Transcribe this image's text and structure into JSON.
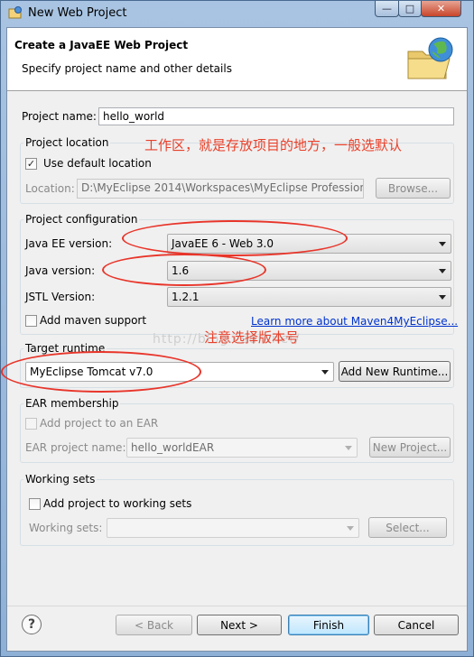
{
  "window": {
    "title": "New Web Project"
  },
  "header": {
    "title": "Create a JavaEE Web Project",
    "subtitle": "Specify project name and other details"
  },
  "project_name": {
    "label": "Project name:",
    "value": "hello_world"
  },
  "project_location": {
    "group_title": "Project location",
    "use_default_label": "Use default location",
    "use_default_checked": true,
    "location_label": "Location:",
    "location_value": "D:\\MyEclipse 2014\\Workspaces\\MyEclipse Profession",
    "browse_label": "Browse..."
  },
  "project_configuration": {
    "group_title": "Project configuration",
    "javaee_label": "Java EE version:",
    "javaee_value": "JavaEE 6 - Web 3.0",
    "java_label": "Java version:",
    "java_value": "1.6",
    "jstl_label": "JSTL Version:",
    "jstl_value": "1.2.1",
    "maven_label": "Add maven support",
    "maven_checked": false,
    "maven_link": "Learn more about Maven4MyEclipse..."
  },
  "target_runtime": {
    "group_title": "Target runtime",
    "value": "MyEclipse Tomcat v7.0",
    "add_button": "Add New Runtime..."
  },
  "ear_membership": {
    "group_title": "EAR membership",
    "add_label": "Add project to an EAR",
    "add_checked": false,
    "project_label": "EAR project name:",
    "project_value": "hello_worldEAR",
    "new_button": "New Project..."
  },
  "working_sets": {
    "group_title": "Working sets",
    "add_label": "Add project to working sets",
    "add_checked": false,
    "sets_label": "Working sets:",
    "sets_value": "",
    "select_button": "Select..."
  },
  "annotations": {
    "workspace_note": "工作区，就是存放项目的地方，一般选默认",
    "version_note": "注意选择版本号",
    "watermark": "http://blog.csdn.net/"
  },
  "buttons": {
    "back": "< Back",
    "next": "Next >",
    "finish": "Finish",
    "cancel": "Cancel"
  },
  "icons": {
    "help": "?"
  },
  "colors": {
    "annotation": "#e8352a",
    "link": "#0033cc"
  }
}
